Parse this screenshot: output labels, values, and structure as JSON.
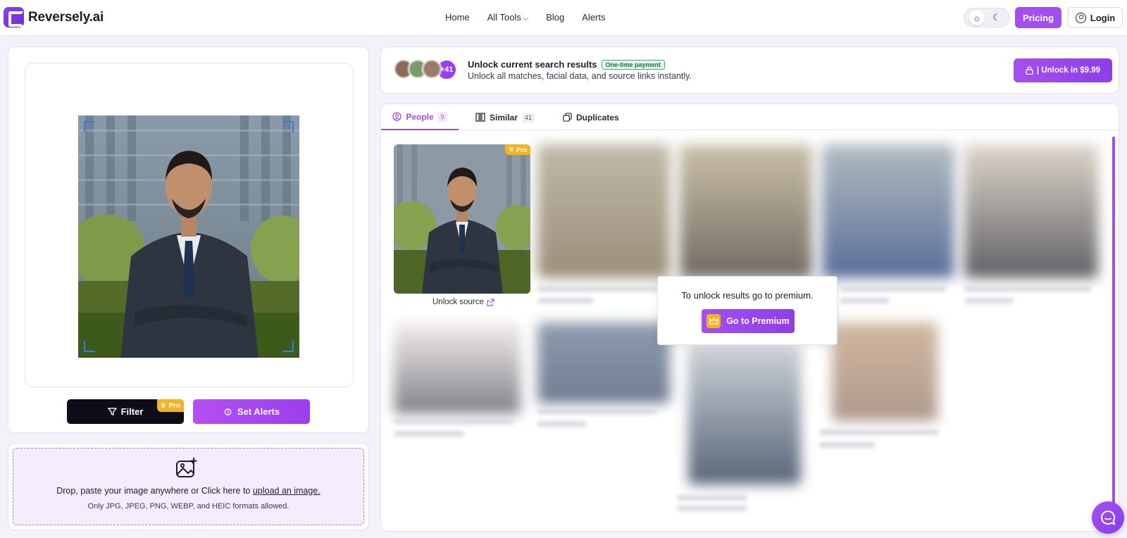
{
  "header": {
    "logo_text": "Reversely.ai",
    "nav": [
      "Home",
      "All Tools",
      "Blog",
      "Alerts"
    ],
    "pricing_label": "Pricing",
    "login_label": "Login",
    "theme_icons": [
      "sun-icon",
      "moon-icon"
    ]
  },
  "left": {
    "filter_label": "Filter",
    "filter_badge": "Pro",
    "alerts_label": "Set Alerts",
    "upload_text_prefix": "Drop, paste your image anywhere or Click here to",
    "upload_link": "upload an image.",
    "upload_formats": "Only JPG, JPEG, PNG, WEBP, and HEIC formats allowed."
  },
  "unlock": {
    "avatar_count": "+41",
    "title": "Unlock current search results",
    "badge": "One-time payment",
    "subtitle": "Unlock all matches, facial data, and source links instantly.",
    "button_label": "| Unlock in $9.99"
  },
  "tabs": [
    {
      "label": "People",
      "count": "9"
    },
    {
      "label": "Similar",
      "count": "41"
    },
    {
      "label": "Duplicates",
      "count": ""
    }
  ],
  "results": {
    "first_badge": "Pro",
    "unlock_source": "Unlock source",
    "premium_text": "To unlock results go to premium.",
    "premium_button": "Go to Premium"
  },
  "colors": {
    "accent": "#a44ff2",
    "pro_badge": "#f5b321",
    "frame_corners": "#2f7df5"
  }
}
